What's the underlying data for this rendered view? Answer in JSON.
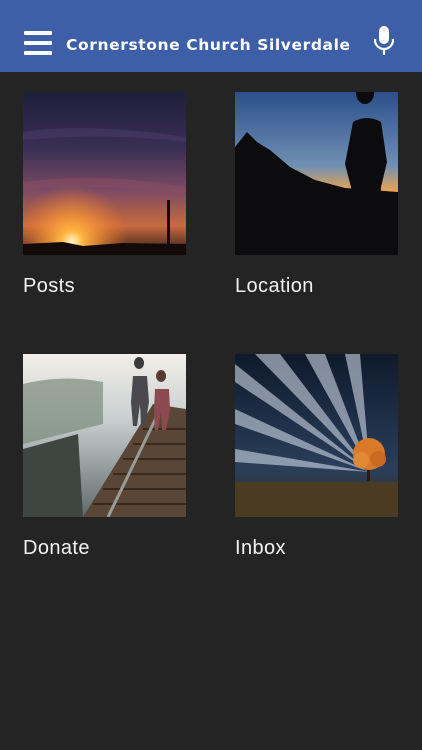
{
  "header": {
    "title": "Cornerstone Church Silverdale",
    "menu_icon": "hamburger-menu-icon",
    "mic_icon": "microphone-icon",
    "background_color": "#3d5fa8"
  },
  "tiles": [
    {
      "label": "Posts",
      "image": "sunset-horizon-image"
    },
    {
      "label": "Location",
      "image": "silhouette-mountain-image"
    },
    {
      "label": "Donate",
      "image": "railroad-bridge-image"
    },
    {
      "label": "Inbox",
      "image": "tree-light-rays-image"
    }
  ]
}
